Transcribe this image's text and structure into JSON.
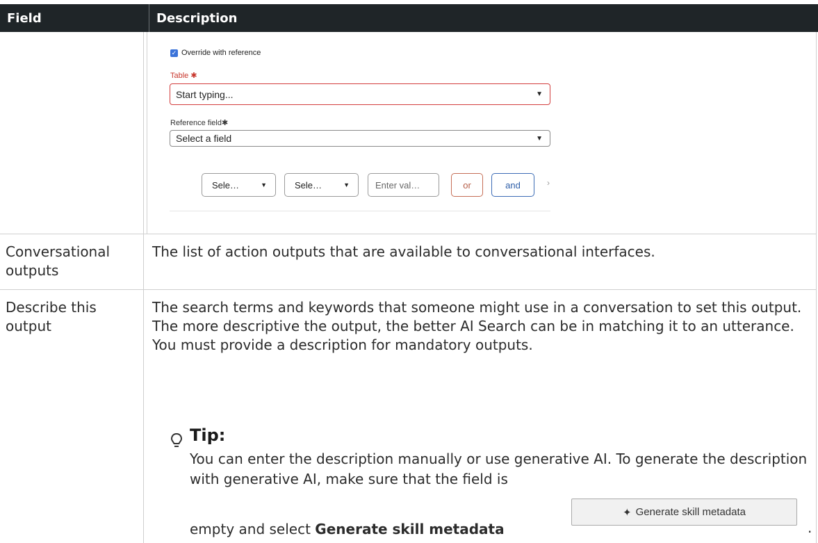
{
  "header": {
    "field": "Field",
    "description": "Description"
  },
  "form_screenshot": {
    "override_label": "Override with reference",
    "table_label": "Table",
    "required_mark": "✱",
    "table_placeholder": "Start typing...",
    "reference_label": "Reference field",
    "reference_placeholder": "Select a field",
    "condition_select_1": "Sele…",
    "condition_select_2": "Sele…",
    "condition_value_placeholder": "Enter val…",
    "or_label": "or",
    "and_label": "and",
    "more_glyph": "›",
    "caret_glyph": "▼"
  },
  "rows": [
    {
      "field": "Conversational outputs",
      "description": "The list of action outputs that are available to conversational interfaces."
    },
    {
      "field": "Describe this output",
      "description": "The search terms and keywords that someone might use in a conversation to set this output. The more descriptive the output, the better AI Search can be in matching it to an utterance. You must provide a description for mandatory outputs."
    }
  ],
  "tip": {
    "title": "Tip:",
    "body": "You can enter the description manually or use generative AI. To generate the description with generative AI, make sure that the field is",
    "last_prefix": "empty and select",
    "last_bold": "Generate skill metadata",
    "button_label": "Generate skill metadata",
    "period": "."
  }
}
